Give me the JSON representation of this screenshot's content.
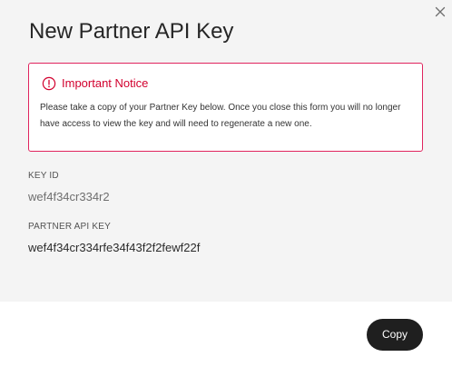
{
  "modal": {
    "title": "New Partner API Key",
    "close_icon": "close-icon"
  },
  "notice": {
    "icon": "exclamation-circle-icon",
    "title": "Important Notice",
    "text": "Please take a copy of your Partner Key below. Once you close this form you will no longer have access to view the key and will need to regenerate a new one."
  },
  "fields": {
    "key_id": {
      "label": "KEY ID",
      "value": "wef4f34cr334r2"
    },
    "api_key": {
      "label": "PARTNER API KEY",
      "value": "wef4f34cr334rfe34f43f2f2fewf22f"
    }
  },
  "footer": {
    "copy_label": "Copy"
  },
  "colors": {
    "accent": "#d2002e",
    "button_bg": "#1f1f1f",
    "body_bg": "#f4f4f4"
  }
}
